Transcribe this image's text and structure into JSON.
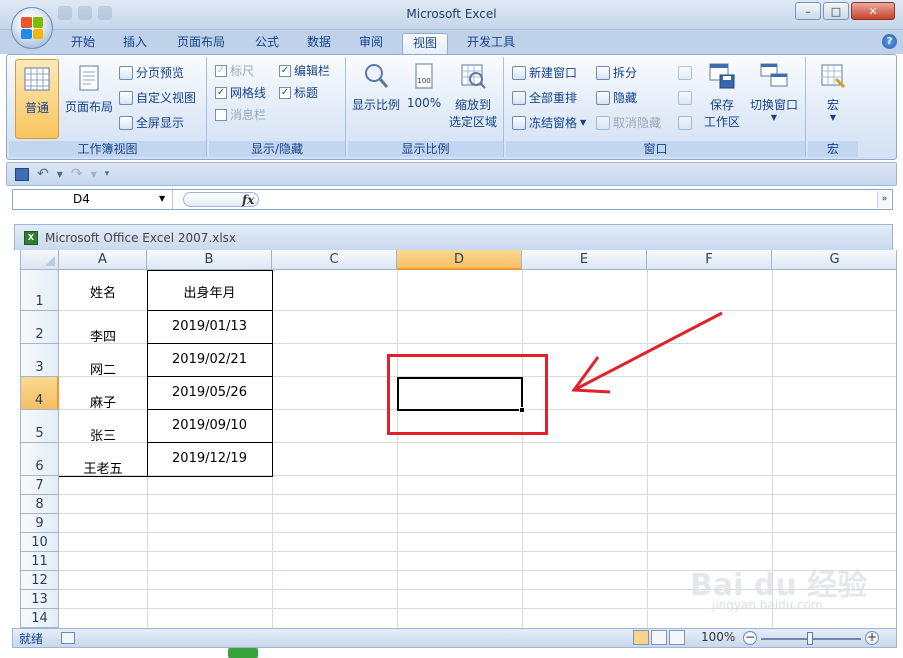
{
  "window": {
    "title": "Microsoft Excel"
  },
  "tabs": [
    "开始",
    "插入",
    "页面布局",
    "公式",
    "数据",
    "审阅",
    "视图",
    "开发工具"
  ],
  "active_tab": "视图",
  "ribbon": {
    "workbook_views": {
      "label": "工作簿视图",
      "normal": "普通",
      "page_layout": "页面布局",
      "page_break": "分页预览",
      "custom_views": "自定义视图",
      "full_screen": "全屏显示"
    },
    "show_hide": {
      "label": "显示/隐藏",
      "ruler": "标尺",
      "formula_bar": "编辑栏",
      "gridlines": "网格线",
      "headings": "标题",
      "message_bar": "消息栏"
    },
    "zoom": {
      "label": "显示比例",
      "zoom": "显示比例",
      "zoom100": "100%",
      "zoom_selection_1": "缩放到",
      "zoom_selection_2": "选定区域"
    },
    "window": {
      "label": "窗口",
      "new_window": "新建窗口",
      "arrange_all": "全部重排",
      "freeze": "冻结窗格",
      "split": "拆分",
      "hide": "隐藏",
      "unhide": "取消隐藏",
      "save_workspace_1": "保存",
      "save_workspace_2": "工作区",
      "switch_windows": "切换窗口"
    },
    "macros": {
      "label": "宏",
      "macros": "宏"
    }
  },
  "formula_bar": {
    "name_box": "D4",
    "fx": "fx",
    "value": ""
  },
  "workbook": {
    "title": "Microsoft Office Excel 2007.xlsx"
  },
  "columns": [
    "A",
    "B",
    "C",
    "D",
    "E",
    "F",
    "G"
  ],
  "selected_column": "D",
  "rows": [
    "1",
    "2",
    "3",
    "4",
    "5",
    "6",
    "7",
    "8",
    "9",
    "10",
    "11",
    "12",
    "13",
    "14"
  ],
  "selected_row": "4",
  "table": {
    "header": {
      "name": "姓名",
      "birth": "出身年月"
    },
    "records": [
      {
        "name": "李四",
        "birth": "2019/01/13"
      },
      {
        "name": "网二",
        "birth": "2019/02/21"
      },
      {
        "name": "麻子",
        "birth": "2019/05/26"
      },
      {
        "name": "张三",
        "birth": "2019/09/10"
      },
      {
        "name": "王老五",
        "birth": "2019/12/19"
      }
    ]
  },
  "status": {
    "ready": "就绪",
    "zoom": "100%"
  },
  "watermark": {
    "brand": "Bai du 经验",
    "url": "jingyan.baidu.com"
  },
  "colors": {
    "annotation": "#e0222b",
    "selected_header": "#f6bf60"
  }
}
